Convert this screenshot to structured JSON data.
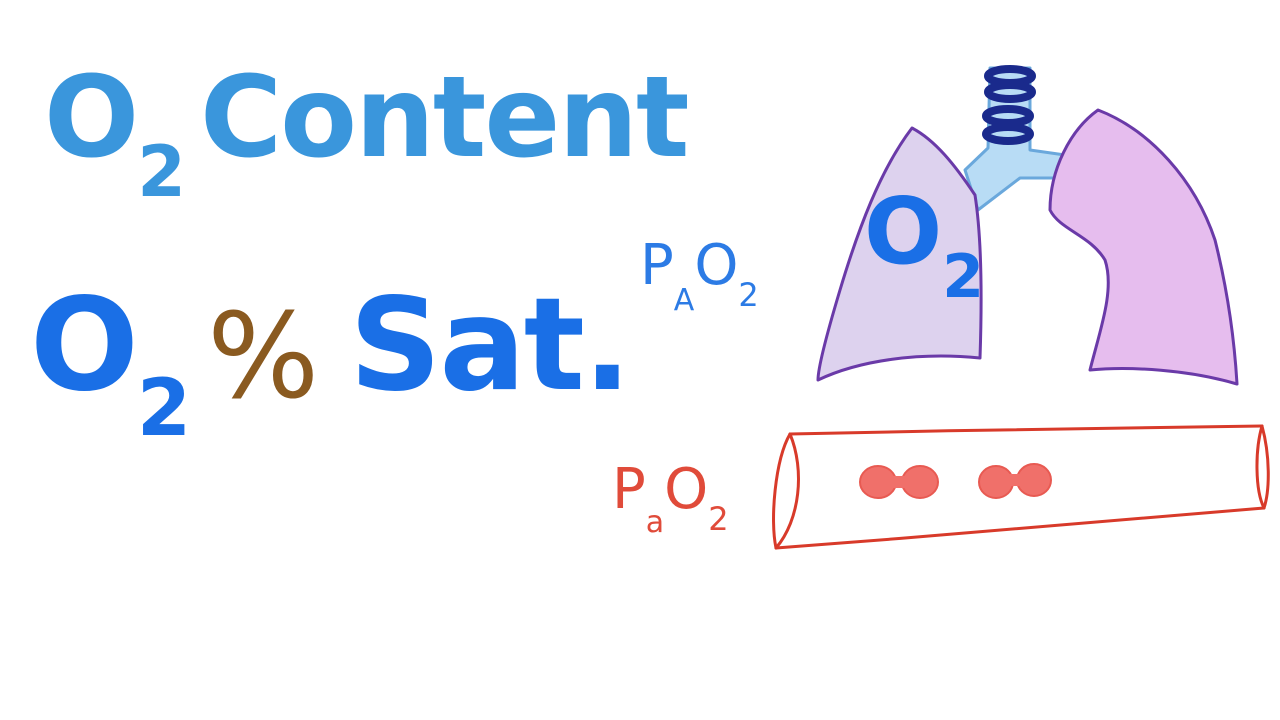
{
  "titles": {
    "content": {
      "o": "O",
      "sub": "2",
      "word": "Content"
    },
    "saturation": {
      "o": "O",
      "sub": "2",
      "percent": "%",
      "word": "Sat."
    }
  },
  "lung": {
    "label": {
      "o": "O",
      "sub": "2"
    },
    "trachea_color": "#b8dcf5",
    "trachea_rings_color": "#1a2a8c",
    "left_lung_fill": "#ddd2ee",
    "right_lung_fill": "#e6bdee",
    "lung_outline": "#6a3aa8"
  },
  "alveolar_label": {
    "p": "P",
    "sub_p": "A",
    "o": "O",
    "sub_o": "2"
  },
  "arterial_label": {
    "p": "P",
    "sub_p": "a",
    "o": "O",
    "sub_o": "2"
  },
  "vessel": {
    "outline_color": "#d83a2a",
    "rbc_color": "#f0706a",
    "rbc_count": 2
  },
  "colors": {
    "content_blue": "#3a96dc",
    "sat_blue": "#1a6fe6",
    "percent_brown": "#8a5a20",
    "alveolar_blue": "#2c7be5",
    "arterial_red": "#e04b3a"
  }
}
